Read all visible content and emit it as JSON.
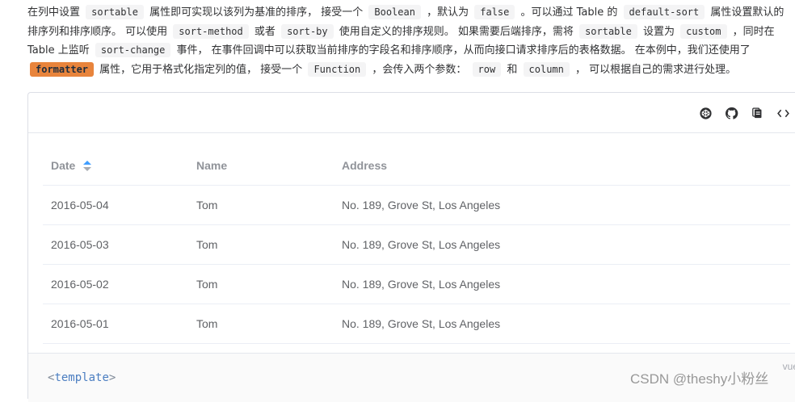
{
  "description": {
    "line1": {
      "t1": "在列中设置",
      "c1": "sortable",
      "t2": "属性即可实现以该列为基准的排序， 接受一个",
      "c2": "Boolean",
      "t3": "，默认为",
      "c3": "false",
      "t4": "。可以通过 Table 的",
      "c4": "default-sort",
      "t5": "属性设置默认的"
    },
    "line2": {
      "t1": "排序列和排序顺序。 可以使用",
      "c1": "sort-method",
      "t2": "或者",
      "c2": "sort-by",
      "t3": "使用自定义的排序规则。 如果需要后端排序，需将",
      "c3": "sortable",
      "t4": "设置为",
      "c4": "custom",
      "t5": "，同时在"
    },
    "line3": {
      "t1": "Table 上监听",
      "c1": "sort-change",
      "t2": "事件， 在事件回调中可以获取当前排序的字段名和排序顺序，从而向接口请求排序后的表格数据。 在本例中，我们还使用了"
    },
    "line4": {
      "c1": "formatter",
      "t1": "属性，它用于格式化指定列的值， 接受一个",
      "c2": "Function",
      "t2": "，会传入两个参数：",
      "c3": "row",
      "t3": "和",
      "c4": "column",
      "t4": "， 可以根据自己的需求进行处理。"
    }
  },
  "toolbar": {
    "icons": [
      "codepen-icon",
      "github-icon",
      "copy-icon",
      "code-icon"
    ]
  },
  "table": {
    "headers": {
      "date": "Date",
      "name": "Name",
      "address": "Address"
    },
    "rows": [
      {
        "date": "2016-05-04",
        "name": "Tom",
        "address": "No. 189, Grove St, Los Angeles"
      },
      {
        "date": "2016-05-03",
        "name": "Tom",
        "address": "No. 189, Grove St, Los Angeles"
      },
      {
        "date": "2016-05-02",
        "name": "Tom",
        "address": "No. 189, Grove St, Los Angeles"
      },
      {
        "date": "2016-05-01",
        "name": "Tom",
        "address": "No. 189, Grove St, Los Angeles"
      }
    ]
  },
  "code": {
    "open": "<",
    "tag": "template",
    "close": ">",
    "lang": "vue"
  },
  "watermark": "CSDN @theshy小粉丝",
  "colors": {
    "sort_active": "#409eff",
    "highlight": "#e8843c",
    "border": "#ebeef5"
  }
}
